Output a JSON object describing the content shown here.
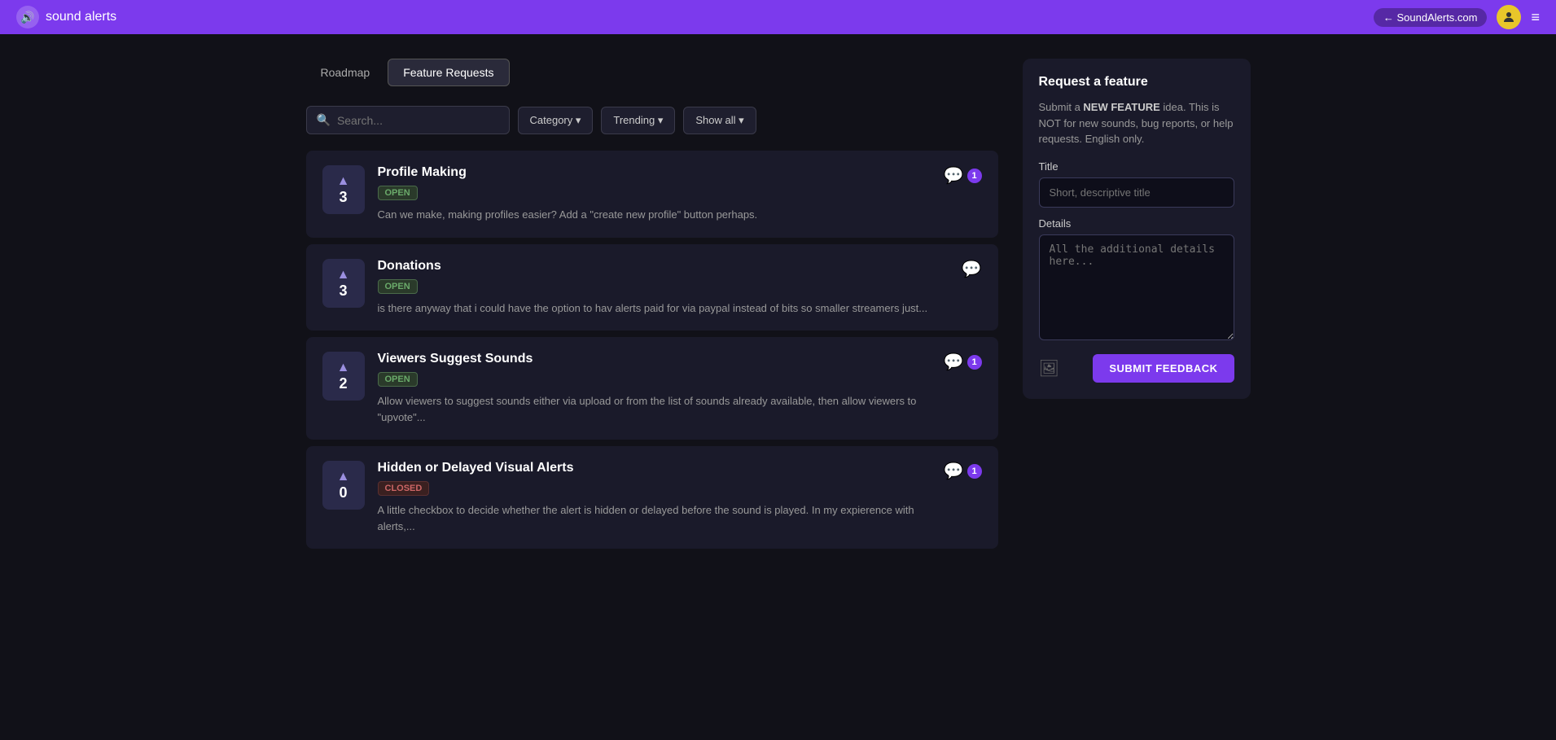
{
  "header": {
    "logo_text": "sound alerts",
    "back_link": "← SoundAlerts.com",
    "menu_icon": "≡"
  },
  "tabs": [
    {
      "id": "roadmap",
      "label": "Roadmap",
      "active": false
    },
    {
      "id": "feature-requests",
      "label": "Feature Requests",
      "active": true
    }
  ],
  "search": {
    "placeholder": "Search..."
  },
  "filters": [
    {
      "id": "category",
      "label": "Category ▾"
    },
    {
      "id": "trending",
      "label": "Trending ▾"
    },
    {
      "id": "show-all",
      "label": "Show all ▾"
    }
  ],
  "features": [
    {
      "id": "profile-making",
      "title": "Profile Making",
      "status": "OPEN",
      "status_type": "open",
      "votes": 3,
      "description": "Can we make, making profiles easier? Add a \"create new profile\" button perhaps.",
      "comments": 1
    },
    {
      "id": "donations",
      "title": "Donations",
      "status": "OPEN",
      "status_type": "open",
      "votes": 3,
      "description": "is there anyway that i could have the option to hav alerts paid for via paypal instead of bits so smaller streamers just...",
      "comments": 0
    },
    {
      "id": "viewers-suggest-sounds",
      "title": "Viewers Suggest Sounds",
      "status": "OPEN",
      "status_type": "open",
      "votes": 2,
      "description": "Allow viewers to suggest sounds either via upload or from the list of sounds already available, then allow viewers to \"upvote\"...",
      "comments": 1
    },
    {
      "id": "hidden-delayed-visual-alerts",
      "title": "Hidden or Delayed Visual Alerts",
      "status": "CLOSED",
      "status_type": "closed",
      "votes": 0,
      "description": "A little checkbox to decide whether the alert is hidden or delayed before the sound is played. In my expierence with alerts,...",
      "comments": 1
    }
  ],
  "request_panel": {
    "title": "Request a feature",
    "description": "Submit a NEW FEATURE idea. This is NOT for new sounds, bug reports, or help requests. English only.",
    "title_label": "Title",
    "title_placeholder": "Short, descriptive title",
    "details_label": "Details",
    "details_placeholder": "All the additional details here...",
    "submit_label": "SUBMIT FEEDBACK"
  }
}
